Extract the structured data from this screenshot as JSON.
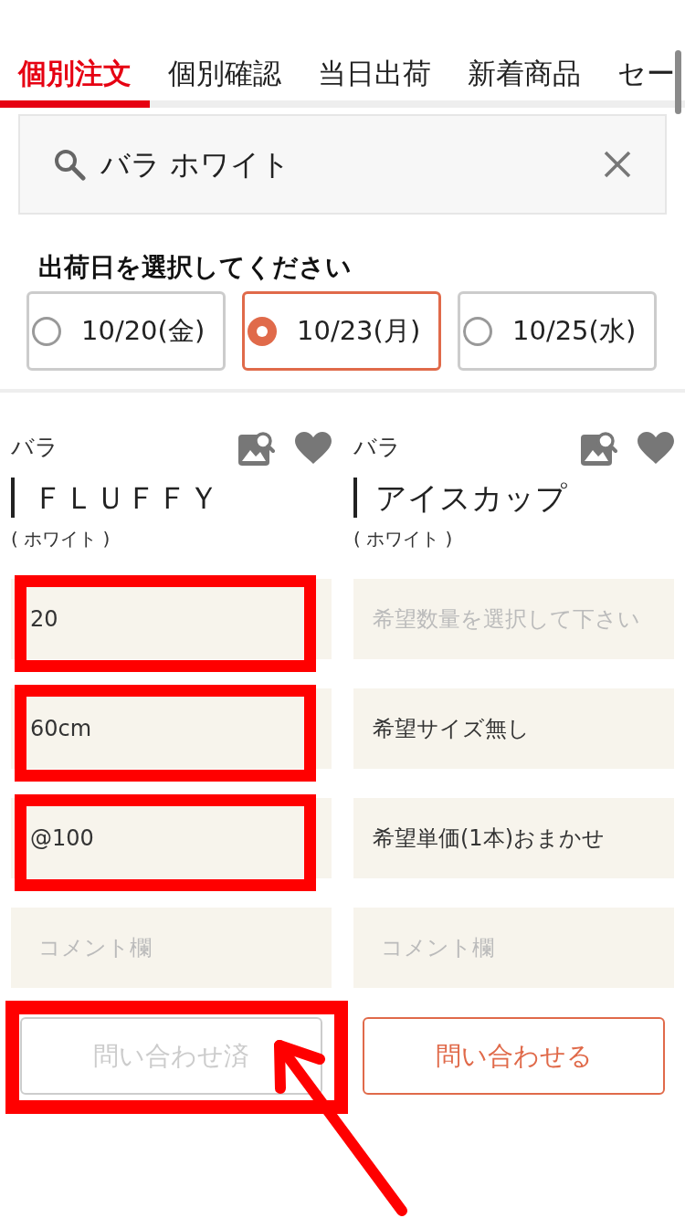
{
  "tabs": [
    {
      "label": "個別注文",
      "selected": true
    },
    {
      "label": "個別確認",
      "selected": false
    },
    {
      "label": "当日出荷",
      "selected": false
    },
    {
      "label": "新着商品",
      "selected": false
    },
    {
      "label": "セー",
      "selected": false
    }
  ],
  "search": {
    "value": "バラ ホワイト"
  },
  "ship_date": {
    "heading": "出荷日を選択してください",
    "options": [
      {
        "label": "10/20(金)",
        "selected": false
      },
      {
        "label": "10/23(月)",
        "selected": true
      },
      {
        "label": "10/25(水)",
        "selected": false
      }
    ]
  },
  "products": [
    {
      "category": "バラ",
      "name": "ＦＬＵＦＦＹ",
      "color_note": "( ホワイト )",
      "fields": [
        {
          "kind": "select",
          "value": "20",
          "highlighted": true
        },
        {
          "kind": "select",
          "value": "60cm",
          "highlighted": true
        },
        {
          "kind": "select",
          "value": "@100",
          "highlighted": true
        },
        {
          "kind": "textarea",
          "placeholder": "コメント欄",
          "highlighted": false
        }
      ],
      "button": {
        "label": "問い合わせ済",
        "disabled": true,
        "highlighted": true,
        "arrow": true
      }
    },
    {
      "category": "バラ",
      "name": "アイスカップ",
      "color_note": "( ホワイト )",
      "fields": [
        {
          "kind": "select",
          "placeholder": "希望数量を選択して下さい",
          "highlighted": false
        },
        {
          "kind": "select",
          "value": "希望サイズ無し",
          "highlighted": false
        },
        {
          "kind": "select",
          "value": "希望単価(1本)おまかせ",
          "highlighted": false
        },
        {
          "kind": "textarea",
          "placeholder": "コメント欄",
          "highlighted": false
        }
      ],
      "button": {
        "label": "問い合わせる",
        "disabled": false,
        "highlighted": false,
        "arrow": false
      }
    }
  ]
}
